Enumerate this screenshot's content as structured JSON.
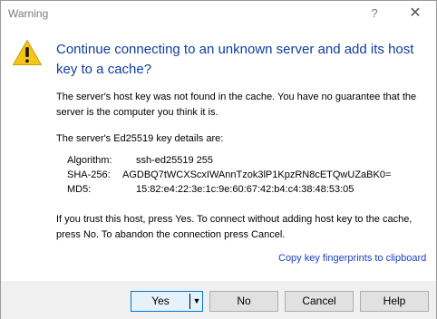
{
  "window": {
    "title": "Warning",
    "help_glyph": "?",
    "close_glyph": "✕"
  },
  "icons": {
    "warning": "warning-icon",
    "dropdown": "chevron-down-icon",
    "warning_color": "#f5c518"
  },
  "heading": "Continue connecting to an unknown server and add its host key to a cache?",
  "paragraph1": "The server's host key was not found in the cache. You have no guarantee that the server is the computer you think it is.",
  "paragraph2": "The server's Ed25519 key details are:",
  "key_details": [
    {
      "label": "Algorithm:",
      "value": "ssh-ed25519 255"
    },
    {
      "label": "SHA-256:",
      "value": "AGDBQ7tWCXScxIWAnnTzok3lP1KpzRN8cETQwUZaBK0="
    },
    {
      "label": "MD5:",
      "value": "15:82:e4:22:3e:1c:9e:60:67:42:b4:c4:38:48:53:05"
    }
  ],
  "paragraph3": "If you trust this host, press Yes. To connect without adding host key to the cache, press No. To abandon the connection press Cancel.",
  "copy_link": "Copy key fingerprints to clipboard",
  "buttons": {
    "yes": "Yes",
    "yes_arrow": "▼",
    "no": "No",
    "cancel": "Cancel",
    "help": "Help"
  },
  "colors": {
    "heading": "#0d3ea3",
    "link": "#1a3fbf",
    "footer_bg": "#f0f0f0",
    "default_button_border": "#0078d7"
  }
}
